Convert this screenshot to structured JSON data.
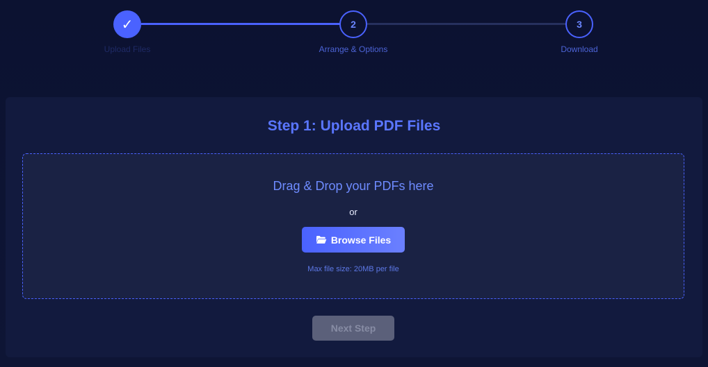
{
  "stepper": {
    "steps": [
      {
        "number": "✓",
        "label": "Upload Files",
        "state": "done"
      },
      {
        "number": "2",
        "label": "Arrange & Options",
        "state": "pending"
      },
      {
        "number": "3",
        "label": "Download",
        "state": "pending"
      }
    ]
  },
  "card": {
    "title": "Step 1: Upload PDF Files",
    "dropzone": {
      "drop_text": "Drag & Drop your PDFs here",
      "or_text": "or",
      "browse_label": "Browse Files",
      "browse_icon": "folder-open-icon",
      "max_size": "Max file size: 20MB per file"
    },
    "next_label": "Next Step"
  },
  "colors": {
    "accent": "#4a62ff",
    "background": "#0d1430",
    "card": "#121a3e",
    "disabled": "#5b607a"
  }
}
